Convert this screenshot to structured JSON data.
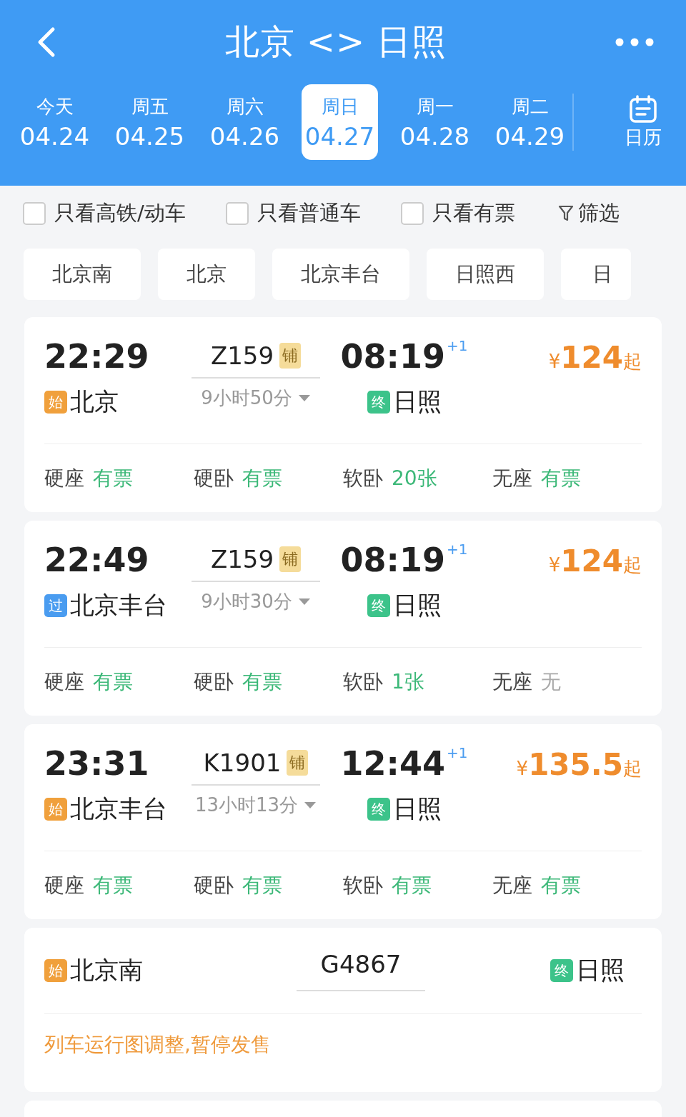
{
  "header": {
    "title": "北京 <> 日照"
  },
  "dates": [
    {
      "weekday": "今天",
      "date": "04.24",
      "selected": false
    },
    {
      "weekday": "周五",
      "date": "04.25",
      "selected": false
    },
    {
      "weekday": "周六",
      "date": "04.26",
      "selected": false
    },
    {
      "weekday": "周日",
      "date": "04.27",
      "selected": true
    },
    {
      "weekday": "周一",
      "date": "04.28",
      "selected": false
    },
    {
      "weekday": "周二",
      "date": "04.29",
      "selected": false
    }
  ],
  "calendar": {
    "label": "日历"
  },
  "filters": [
    {
      "label": "只看高铁/动车",
      "checked": false
    },
    {
      "label": "只看普通车",
      "checked": false
    },
    {
      "label": "只看有票",
      "checked": false
    }
  ],
  "filter_button": {
    "label": "筛选"
  },
  "stations": [
    "北京南",
    "北京",
    "北京丰台",
    "日照西",
    "日"
  ],
  "trains": [
    {
      "kind": "normal",
      "depart": "22:29",
      "from_tag": {
        "kind": "start",
        "text": "始"
      },
      "from": "北京",
      "number": "Z159",
      "badge": "铺",
      "duration": "9小时50分",
      "arrive": "08:19",
      "day_offset": "+1",
      "to_tag": {
        "kind": "end",
        "text": "终"
      },
      "to": "日照",
      "currency": "¥",
      "price": "124",
      "price_suffix": "起",
      "seats": [
        {
          "name": "硬座",
          "status": "有票",
          "available": true
        },
        {
          "name": "硬卧",
          "status": "有票",
          "available": true
        },
        {
          "name": "软卧",
          "status": "20张",
          "available": true
        },
        {
          "name": "无座",
          "status": "有票",
          "available": true
        }
      ]
    },
    {
      "kind": "normal",
      "depart": "22:49",
      "from_tag": {
        "kind": "pass",
        "text": "过"
      },
      "from": "北京丰台",
      "number": "Z159",
      "badge": "铺",
      "duration": "9小时30分",
      "arrive": "08:19",
      "day_offset": "+1",
      "to_tag": {
        "kind": "end",
        "text": "终"
      },
      "to": "日照",
      "currency": "¥",
      "price": "124",
      "price_suffix": "起",
      "seats": [
        {
          "name": "硬座",
          "status": "有票",
          "available": true
        },
        {
          "name": "硬卧",
          "status": "有票",
          "available": true
        },
        {
          "name": "软卧",
          "status": "1张",
          "available": true
        },
        {
          "name": "无座",
          "status": "无",
          "available": false
        }
      ]
    },
    {
      "kind": "normal",
      "depart": "23:31",
      "from_tag": {
        "kind": "start",
        "text": "始"
      },
      "from": "北京丰台",
      "number": "K1901",
      "badge": "铺",
      "duration": "13小时13分",
      "arrive": "12:44",
      "day_offset": "+1",
      "to_tag": {
        "kind": "end",
        "text": "终"
      },
      "to": "日照",
      "currency": "¥",
      "price": "135.5",
      "price_suffix": "起",
      "seats": [
        {
          "name": "硬座",
          "status": "有票",
          "available": true
        },
        {
          "name": "硬卧",
          "status": "有票",
          "available": true
        },
        {
          "name": "软卧",
          "status": "有票",
          "available": true
        },
        {
          "name": "无座",
          "status": "有票",
          "available": true
        }
      ]
    },
    {
      "kind": "suspended",
      "from_tag": {
        "kind": "start",
        "text": "始"
      },
      "from": "北京南",
      "number": "G4867",
      "to_tag": {
        "kind": "end",
        "text": "终"
      },
      "to": "日照",
      "notice": "列车运行图调整,暂停发售"
    }
  ]
}
